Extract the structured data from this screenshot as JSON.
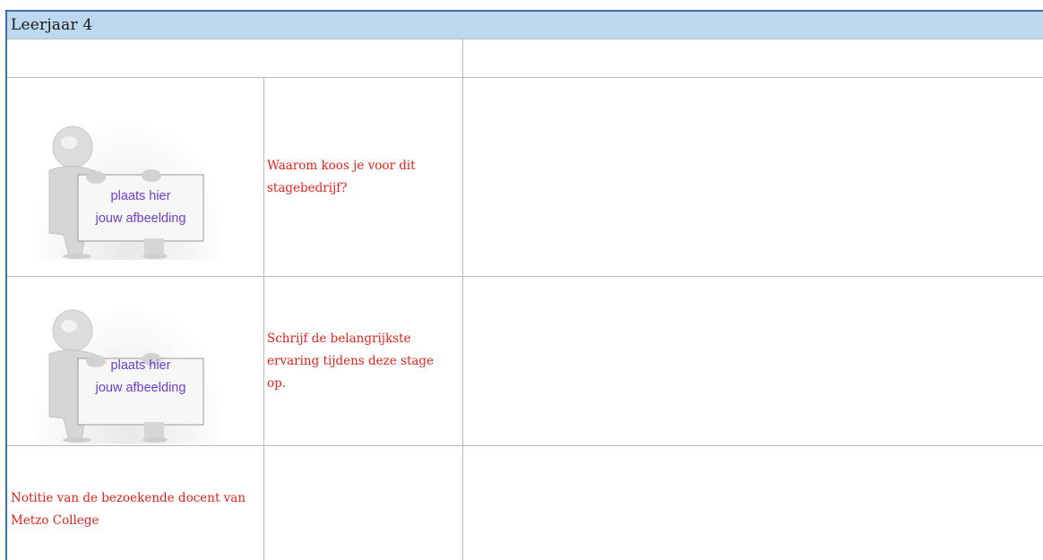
{
  "header": {
    "title": "Leerjaar 4"
  },
  "rows": [
    {
      "image_line1": "plaats hier",
      "image_line2": "jouw afbeelding",
      "question": "Waarom koos je voor dit stagebedrijf?"
    },
    {
      "image_line1": "plaats hier",
      "image_line2": "jouw afbeelding",
      "question": "Schrijf de belangrijkste ervaring tijdens deze stage op."
    }
  ],
  "note_row": {
    "label": "Notitie van de bezoekende docent van Metzo College"
  },
  "colors": {
    "header_bg": "#bdd7ee",
    "border": "#3d6fa8",
    "grid": "#b9b9b9",
    "question_text": "#e8211a",
    "sign_text": "#6b3fd6"
  },
  "icons": {
    "placeholder": "person-holding-sign-icon"
  }
}
